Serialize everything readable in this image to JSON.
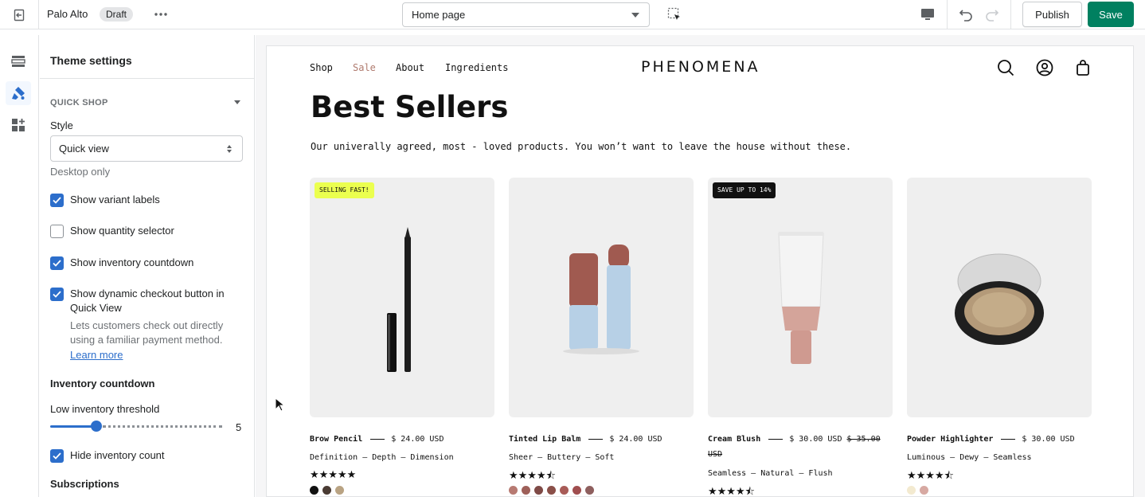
{
  "topbar": {
    "store_name": "Palo Alto",
    "status_badge": "Draft",
    "page_selector": "Home page",
    "publish_label": "Publish",
    "save_label": "Save"
  },
  "icons": {
    "exit": "exit-icon",
    "more": "more-horizontal-icon",
    "inspect": "select-element-icon",
    "desktop": "desktop-icon",
    "undo": "undo-icon",
    "redo": "redo-icon",
    "rail": [
      "sections-icon",
      "theme-settings-icon",
      "apps-icon"
    ]
  },
  "colors": {
    "primary_button": "#008060",
    "checkbox": "#2c6ecb",
    "sale_nav": "#b07b6f",
    "badge_yellow": "#ebff4f"
  },
  "panel": {
    "title": "Theme settings",
    "section": "QUICK SHOP",
    "style_label": "Style",
    "style_value": "Quick view",
    "style_help": "Desktop only",
    "checkboxes": [
      {
        "label": "Show variant labels",
        "checked": true
      },
      {
        "label": "Show quantity selector",
        "checked": false
      },
      {
        "label": "Show inventory countdown",
        "checked": true
      },
      {
        "label": "Show dynamic checkout button in Quick View",
        "checked": true
      }
    ],
    "dynamic_help": "Lets customers check out directly using a familiar payment method.",
    "learn_more": "Learn more",
    "inventory_heading": "Inventory countdown",
    "threshold_label": "Low inventory threshold",
    "threshold_value": "5",
    "threshold_fraction": 0.27,
    "hide_count": {
      "label": "Hide inventory count",
      "checked": true
    },
    "subscriptions_heading": "Subscriptions"
  },
  "store": {
    "nav": [
      "Shop",
      "Sale",
      "About",
      "Ingredients"
    ],
    "brand": "PHENOMENA",
    "headline": "Best Sellers",
    "subheadline": "Our univerally agreed, most - loved products. You won’t want to leave the house without these.",
    "products": [
      {
        "name": "Brow Pencil",
        "price": "$ 24.00 USD",
        "compare": "",
        "desc": "Definition — Depth — Dimension",
        "rating": 5.0,
        "stars": "★★★★★",
        "badge": "SELLING FAST!",
        "swatches": [
          "#111111",
          "#4a3b33",
          "#b9a383"
        ]
      },
      {
        "name": "Tinted Lip Balm",
        "price": "$ 24.00 USD",
        "compare": "",
        "desc": "Sheer — Buttery — Soft",
        "rating": 4.5,
        "stars": "★★★★⯪",
        "badge": "",
        "swatches": [
          "#b77a72",
          "#9e6059",
          "#7f4a46",
          "#8a4f48",
          "#a85b57",
          "#a04e4f",
          "#8e5f5e"
        ]
      },
      {
        "name": "Cream Blush",
        "price": "$ 30.00 USD",
        "compare": "$ 35.00 USD",
        "desc": "Seamless — Natural — Flush",
        "rating": 4.5,
        "stars": "★★★★⯪",
        "badge": "SAVE UP TO 14%",
        "swatches": []
      },
      {
        "name": "Powder Highlighter",
        "price": "$ 30.00 USD",
        "compare": "",
        "desc": "Luminous — Dewy — Seamless",
        "rating": 4.5,
        "stars": "★★★★⯪",
        "badge": "",
        "swatches": [
          "#f3ead0",
          "#d7a9a2"
        ]
      }
    ]
  }
}
